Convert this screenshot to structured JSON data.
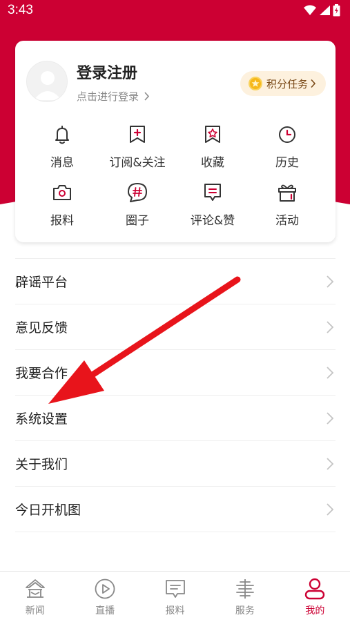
{
  "colors": {
    "brand": "#cc0033",
    "card_bg": "#ffffff",
    "points_bg": "#fdf1de",
    "text_gray": "#8a8a8a"
  },
  "status_bar": {
    "time": "3:43"
  },
  "profile": {
    "title": "登录注册",
    "hint": "点击进行登录",
    "points_label": "积分任务"
  },
  "shortcuts": [
    {
      "label": "消息",
      "icon": "bell-icon"
    },
    {
      "label": "订阅&关注",
      "icon": "bookmark-plus-icon"
    },
    {
      "label": "收藏",
      "icon": "star-bookmark-icon"
    },
    {
      "label": "历史",
      "icon": "clock-icon"
    },
    {
      "label": "报料",
      "icon": "camera-icon"
    },
    {
      "label": "圈子",
      "icon": "hashtag-bubble-icon"
    },
    {
      "label": "评论&赞",
      "icon": "comment-icon"
    },
    {
      "label": "活动",
      "icon": "gift-icon"
    }
  ],
  "menu": [
    {
      "label": "辟谣平台"
    },
    {
      "label": "意见反馈"
    },
    {
      "label": "我要合作"
    },
    {
      "label": "系统设置"
    },
    {
      "label": "关于我们"
    },
    {
      "label": "今日开机图"
    }
  ],
  "bottom_nav": [
    {
      "label": "新闻",
      "icon": "news-icon",
      "active": false
    },
    {
      "label": "直播",
      "icon": "play-icon",
      "active": false
    },
    {
      "label": "报料",
      "icon": "report-icon",
      "active": false
    },
    {
      "label": "服务",
      "icon": "service-icon",
      "active": false
    },
    {
      "label": "我的",
      "icon": "user-icon",
      "active": true
    }
  ]
}
